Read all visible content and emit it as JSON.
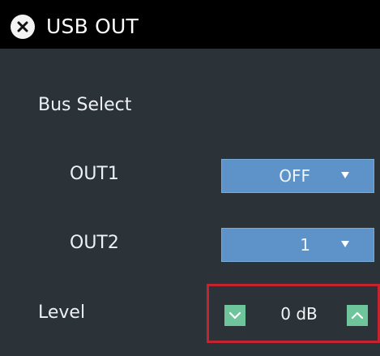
{
  "header": {
    "title": "USB OUT",
    "close_icon": "close-icon"
  },
  "bus_select": {
    "label": "Bus Select",
    "rows": [
      {
        "label": "OUT1",
        "value": "OFF"
      },
      {
        "label": "OUT2",
        "value": "1"
      }
    ]
  },
  "level": {
    "label": "Level",
    "value": "0 dB",
    "down_icon": "chevron-down-icon",
    "up_icon": "chevron-up-icon"
  },
  "colors": {
    "background": "#2b3238",
    "header": "#000000",
    "dropdown": "#5e93c9",
    "stepper_button": "#6ec59b",
    "highlight_frame": "#c4232f"
  }
}
